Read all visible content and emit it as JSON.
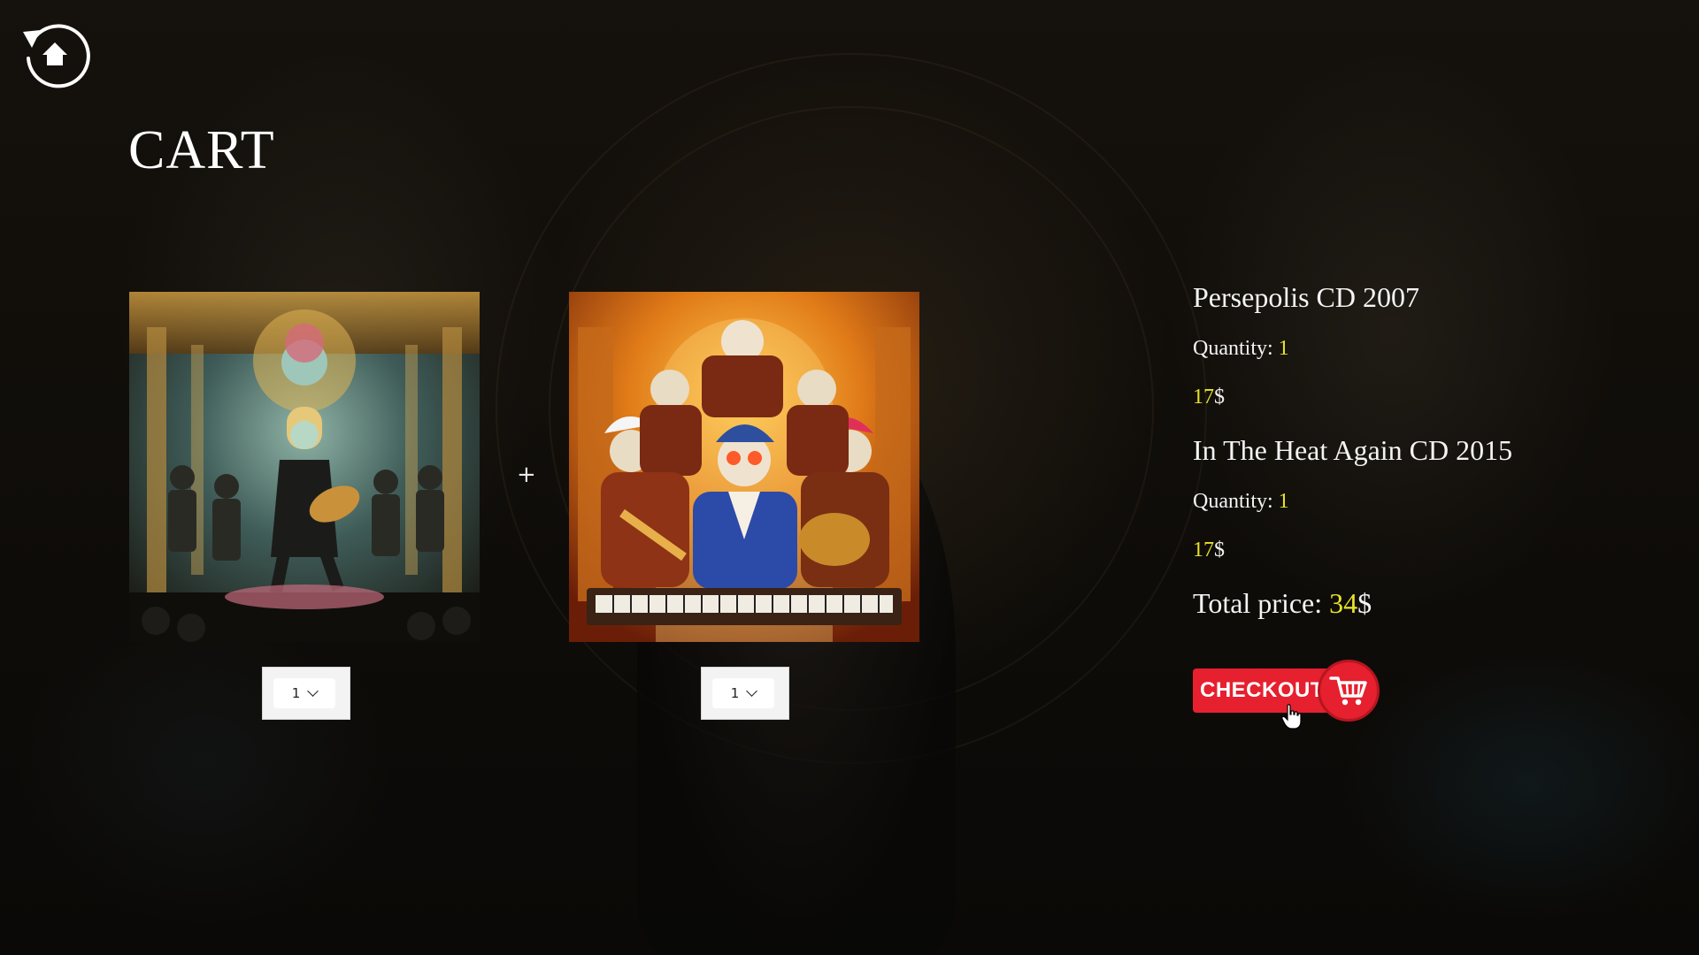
{
  "page": {
    "title": "CART"
  },
  "nav": {
    "home_icon": "home-back-icon"
  },
  "cart": {
    "items": [
      {
        "title": "Persepolis CD 2007",
        "quantity_label": "Quantity: ",
        "quantity": "1",
        "price_value": "17",
        "currency": "$",
        "select_value": "1"
      },
      {
        "title": "In The Heat Again CD 2015",
        "quantity_label": "Quantity: ",
        "quantity": "1",
        "price_value": "17",
        "currency": "$",
        "select_value": "1"
      }
    ],
    "separator": "+",
    "total_label": "Total price: ",
    "total_value": "34",
    "total_currency": "$",
    "checkout_label": "CHECKOUT"
  },
  "colors": {
    "accent_yellow": "#e7e32a",
    "checkout_red": "#e6202e",
    "text": "#f4f4f4"
  }
}
